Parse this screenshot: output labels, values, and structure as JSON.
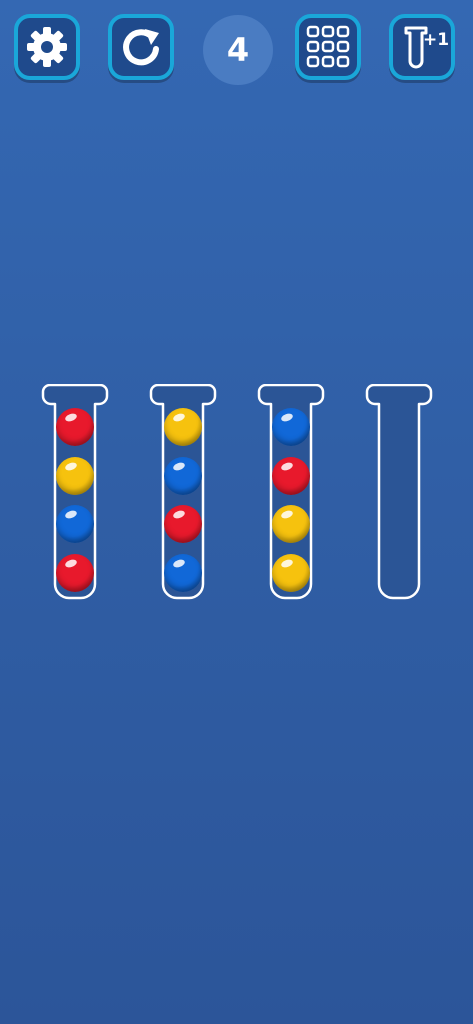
{
  "toolbar": {
    "settings_icon": "gear-icon",
    "restart_icon": "restart-icon",
    "level_value": "4",
    "levels_icon": "grid-icon",
    "add_tube_icon": "add-tube-icon",
    "add_tube_label": "+1"
  },
  "colors": {
    "red": "#e8192c",
    "yellow": "#f6c20e",
    "blue": "#1168d8",
    "accent": "#1aa7d9"
  },
  "tubes": [
    {
      "balls": [
        "red",
        "yellow",
        "blue",
        "red"
      ]
    },
    {
      "balls": [
        "yellow",
        "blue",
        "red",
        "blue"
      ]
    },
    {
      "balls": [
        "blue",
        "red",
        "yellow",
        "yellow"
      ]
    },
    {
      "balls": []
    }
  ]
}
